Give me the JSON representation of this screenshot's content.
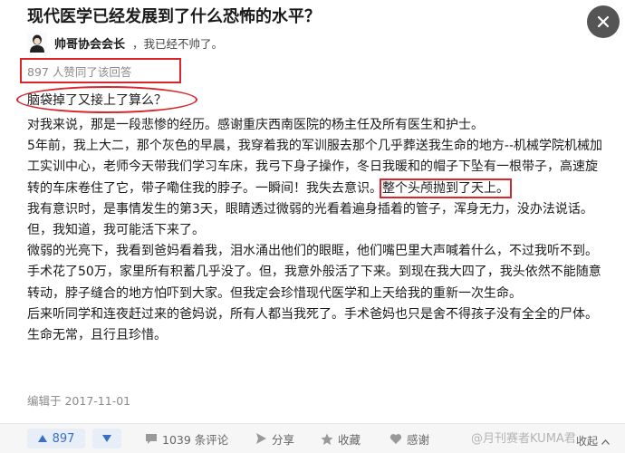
{
  "question": {
    "title": "现代医学已经发展到了什么恐怖的水平？"
  },
  "author": {
    "name": "帅哥协会会长",
    "bio": "，我已经不帅了。"
  },
  "answer": {
    "votes_text": "897 人赞同了该回答",
    "quoted_question": "脑袋掉了又接上了算么？",
    "paragraphs": [
      {
        "text": "对我来说，那是一段悲惨的经历。感谢重庆西南医院的杨主任及所有医生和护士。"
      },
      {
        "text": "5年前，我上大二，那个灰色的早晨，我穿着我的军训服去那个几乎葬送我生命的地方--机械学院机械加工实训中心，老师今天带我们学习车床，我弓下身子操作，冬日我暖和的帽子下坠有一根带子，高速旋转的车床卷住了它，带子嘞住我的脖子。一瞬间！我失去意识。",
        "highlight": "整个头颅抛到了天上。"
      },
      {
        "text": "我有意识时，是事情发生的第3天，眼睛透过微弱的光看着遍身插着的管子，浑身无力，没办法说话。但，我知道，我可能活下来了。"
      },
      {
        "text": "微弱的光亮下，我看到爸妈看着我，泪水涌出他们的眼眶，他们嘴巴里大声喊着什么，不过我听不到。"
      },
      {
        "text": "手术花了50万，家里所有积蓄几乎没了。但，我意外般活了下来。到现在我大四了，我头依然不能随意转动，脖子缝合的地方怕吓到大家。但我定会珍惜现代医学和上天给我的重新一次生命。"
      },
      {
        "text": "后来听同学和连夜赶过来的爸妈说，所有人都当我死了。手术爸妈也只是舍不得孩子没有全全的尸体。生命无常，且行且珍惜。"
      }
    ],
    "edited": "编辑于 2017-11-01"
  },
  "actions": {
    "upvote_count": "897",
    "comments": "1039 条评论",
    "share": "分享",
    "collect": "收藏",
    "thanks": "感谢",
    "collapse": "收起"
  },
  "watermark": "@月刊赛者KUMA君",
  "colors": {
    "accent": "#3a6fc4",
    "annotation_red": "#d9262c",
    "muted": "#8a8a8a"
  },
  "icons": [
    "close-icon",
    "avatar-icon",
    "upvote-arrow-icon",
    "downvote-arrow-icon",
    "comment-icon",
    "share-icon",
    "star-icon",
    "heart-icon",
    "chevron-up-icon"
  ]
}
